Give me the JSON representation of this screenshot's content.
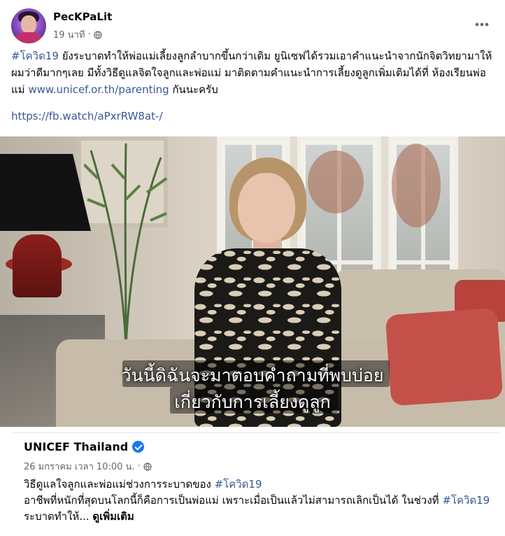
{
  "post": {
    "author": "PecKPaLit",
    "time": "19 นาที",
    "separator": "·",
    "text": {
      "hashtag": "#โควิด19",
      "body1": " ยังระบาดทำให้พ่อแม่เลี้ยงลูกลำบากขึ้นกว่าเดิม ยูนิเซฟได้รวมเอาคำแนะนำจากนักจิตวิทยามาให้ ผมว่าดีมากๆเลย มีทั้งวิธีดูแลจิตใจลูกและพ่อแม่ มาติดตามคำแนะนำการเลี้ยงดูลูกเพิ่มเติมได้ที่ ห้องเรียนพ่อแม่ ",
      "link": "www.unicef.or.th/parenting",
      "body2": " กันนะครับ"
    },
    "fb_link": "https://fb.watch/aPxrRW8at-/",
    "more_icon": "more-horizontal-icon",
    "audience_icon": "globe-icon"
  },
  "video": {
    "subtitle_line1": "วันนี้ดิฉันจะมาตอบคำถามที่พบบ่อย",
    "subtitle_line2": "เกี่ยวกับการเลี้ยงดูลูก"
  },
  "shared": {
    "author": "UNICEF Thailand",
    "verified_icon": "verified-badge-icon",
    "time": "26 มกราคม เวลา 10:00 น.",
    "separator": "·",
    "line1_text": "วิธีดูแลใจลูกและพ่อแม่ช่วงการระบาดของ ",
    "line1_hashtag": "#โควิด19",
    "line2_text": "อาชีพที่หนักที่สุดบนโลกนี้ก็คือการเป็นพ่อแม่ เพราะเมื่อเป็นแล้วไม่สามารถเลิกเป็นได้ ในช่วงที่ ",
    "line2_hashtag": "#โควิด19",
    "line2_tail": " ระบาดทำให้... ",
    "see_more": "ดูเพิ่มเติม"
  },
  "colors": {
    "link": "#385898",
    "meta": "#65676b",
    "verified": "#1877f2"
  }
}
